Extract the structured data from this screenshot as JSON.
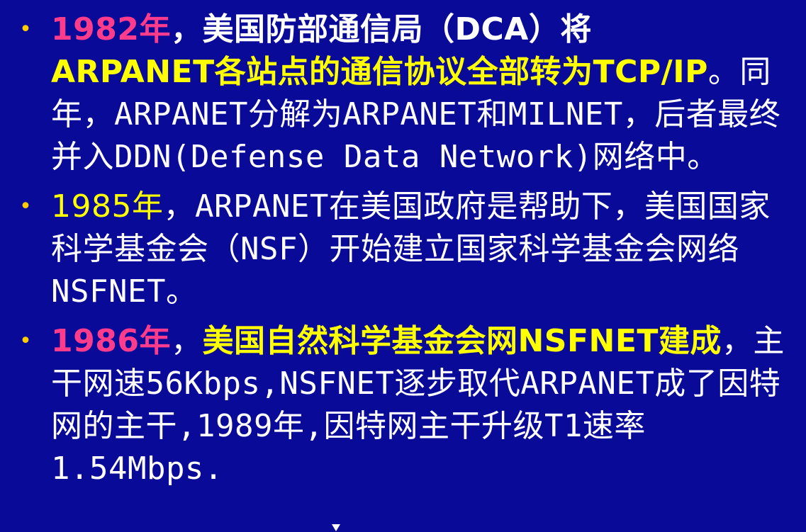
{
  "colors": {
    "background": "#0a0a99",
    "bullet": "#ffcc00",
    "year_highlight": "#ff3b8c",
    "emphasis": "#ffff00",
    "body_text": "#ffffff"
  },
  "bullets": [
    {
      "marker": "•",
      "year": "1982年",
      "p1": "，美国防部通信局（",
      "p2": "DCA",
      "p3": "）将",
      "highlight": "ARPANET各站点的通信协议全部转为TCP/IP",
      "rest": "。同年，ARPANET分解为ARPANET和MILNET，后者最终并入DDN(Defense Data Network)网络中。"
    },
    {
      "marker": "•",
      "year": "1985年",
      "rest": "，ARPANET在美国政府是帮助下，美国国家科学基金会（NSF）开始建立国家科学基金会网络NSFNET。"
    },
    {
      "marker": "•",
      "year": "1986年",
      "p1": "，",
      "highlight": "美国自然科学基金会网NSFNET建成",
      "rest": "，主干网速56Kbps,NSFNET逐步取代ARPANET成了因特网的主干,1989年,因特网主干升级T1速率1.54Mbps."
    }
  ]
}
